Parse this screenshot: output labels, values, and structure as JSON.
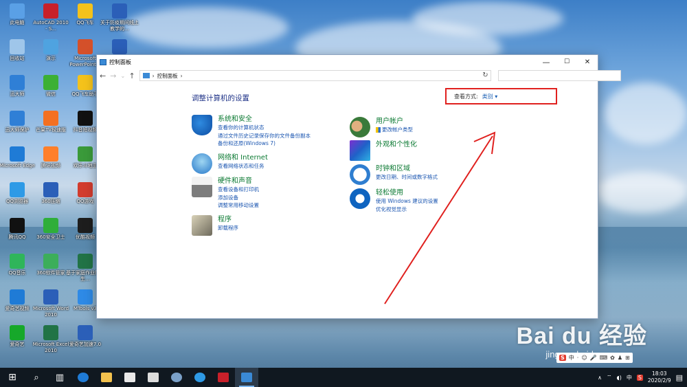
{
  "desktop": {
    "icons": [
      {
        "label": "此电脑",
        "color": "#5aa0e6"
      },
      {
        "label": "AutoCAD 2010 - S...",
        "color": "#c8202a"
      },
      {
        "label": "QQ飞车",
        "color": "#f4c21b"
      },
      {
        "label": "关于防疫期间线上教学的...",
        "color": "#2b5fb8"
      },
      {
        "label": "回收站",
        "color": "#9fc6ea"
      },
      {
        "label": "演示",
        "color": "#4fa3e0"
      },
      {
        "label": "Microsoft PowerPoint...",
        "color": "#d4502a"
      },
      {
        "label": "",
        "color": "#2b5fb8"
      },
      {
        "label": "迅大师",
        "color": "#2f7fd6"
      },
      {
        "label": "微信",
        "color": "#3cb035"
      },
      {
        "label": "QQ飞车助手",
        "color": "#f4c21b"
      },
      {
        "label": "迅大师保护",
        "color": "#2f7fd6"
      },
      {
        "label": "芒果TV极速版",
        "color": "#f37021"
      },
      {
        "label": "抖音短视频",
        "color": "#111111"
      },
      {
        "label": "Microsoft Edge",
        "color": "#1f7bd6"
      },
      {
        "label": "腾讯视频",
        "color": "#ff7f2a"
      },
      {
        "label": "欢乐斗地主",
        "color": "#3a9a3a"
      },
      {
        "label": "QQ浏览器",
        "color": "#2e9ae6"
      },
      {
        "label": "360压缩",
        "color": "#2b5fb8"
      },
      {
        "label": "QQ游戏",
        "color": "#d23c2e"
      },
      {
        "label": "腾讯QQ",
        "color": "#111111"
      },
      {
        "label": "360安全卫士",
        "color": "#2fae3a"
      },
      {
        "label": "优酷视频",
        "color": "#1d1d1d"
      },
      {
        "label": "QQ音乐",
        "color": "#2fb55a"
      },
      {
        "label": "360软件管家",
        "color": "#3cae5a"
      },
      {
        "label": "基于家庭作业的学生...",
        "color": "#217346"
      },
      {
        "label": "爱奇艺视频",
        "color": "#1f7bd6"
      },
      {
        "label": "Microsoft Word 2010",
        "color": "#2b5fb8"
      },
      {
        "label": "MTools v3",
        "color": "#2e8ae6"
      },
      {
        "label": "爱奇艺",
        "color": "#16a82a"
      },
      {
        "label": "Microsoft Excel 2010",
        "color": "#217346"
      },
      {
        "label": "爱奇艺加速7.0",
        "color": "#2b5fb8"
      }
    ]
  },
  "window": {
    "title": "控制面板",
    "controls": {
      "minimize": "—",
      "maximize": "☐",
      "close": "✕"
    },
    "nav": {
      "back": "←",
      "forward": "→",
      "dropdown": "⌄",
      "up": "↑"
    },
    "address": {
      "separator": "›",
      "path": "控制面板",
      "trailing": "›",
      "refresh": "↻"
    },
    "search_placeholder": "",
    "heading": "调整计算机的设置",
    "view_by": {
      "label": "查看方式:",
      "value": "类别 ▾"
    },
    "categories_left": [
      {
        "title": "系统和安全",
        "links": [
          "查看你的计算机状态",
          "通过文件历史记录保存你的文件备份副本",
          "备份和还原(Windows 7)"
        ],
        "icon": "shield-icon"
      },
      {
        "title": "网络和 Internet",
        "links": [
          "查看网络状态和任务"
        ],
        "icon": "network-icon"
      },
      {
        "title": "硬件和声音",
        "links": [
          "查看设备和打印机",
          "添加设备",
          "调整常用移动设置"
        ],
        "icon": "printer-icon"
      },
      {
        "title": "程序",
        "links": [
          "卸载程序"
        ],
        "icon": "programs-icon"
      }
    ],
    "categories_right": [
      {
        "title": "用户帐户",
        "links": [
          "更改帐户类型"
        ],
        "icon": "users-icon"
      },
      {
        "title": "外观和个性化",
        "links": [],
        "icon": "appearance-icon"
      },
      {
        "title": "时钟和区域",
        "links": [
          "更改日期、时间或数字格式"
        ],
        "icon": "clock-icon"
      },
      {
        "title": "轻松使用",
        "links": [
          "使用 Windows 建议的设置",
          "优化视觉显示"
        ],
        "icon": "accessibility-icon"
      }
    ]
  },
  "taskbar": {
    "start": "⊞",
    "search": "⌕",
    "taskview": "▥",
    "tray_chevron": "∧",
    "ime": "中",
    "time": "18:03",
    "date": "2020/2/9"
  },
  "watermark": {
    "main": "Bai du 经验",
    "sub": "jingyan.baidu.com"
  },
  "ime_bar": {
    "logo": "S",
    "items": [
      "中",
      "·",
      "☺",
      "🎤",
      "⌨",
      "✿",
      "♟",
      "⊞"
    ]
  },
  "colors": {
    "highlight_box": "#e0201e",
    "link": "#1a55b0",
    "category": "#0c7a33",
    "heading": "#1e3287"
  }
}
